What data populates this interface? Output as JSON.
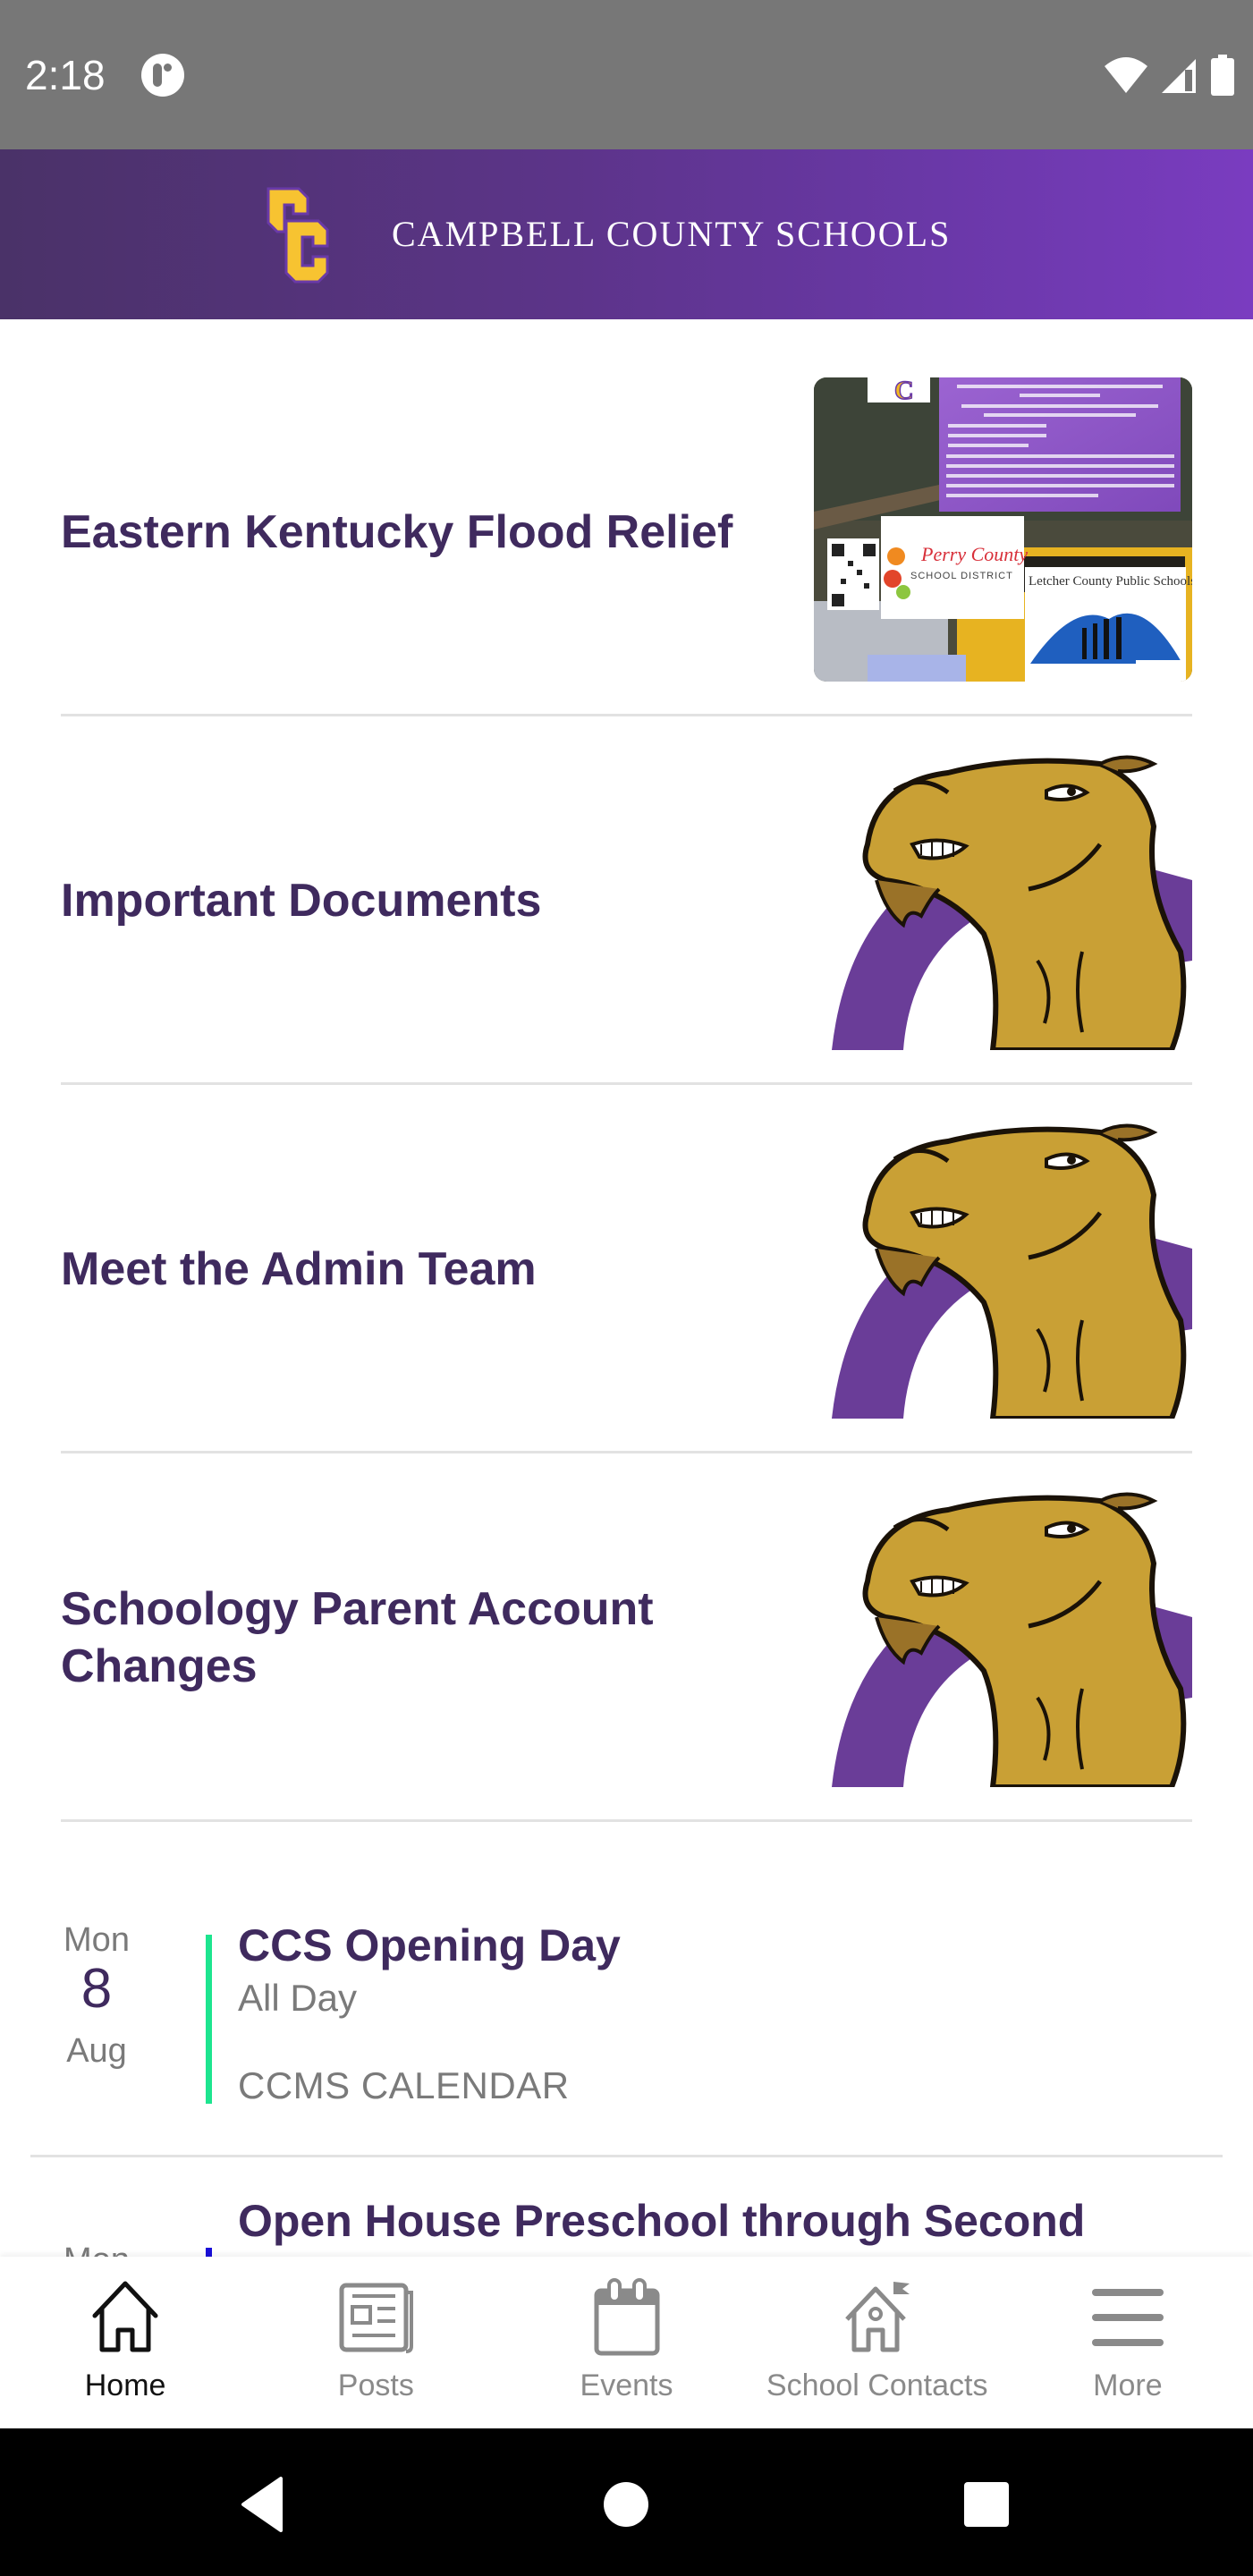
{
  "status_bar": {
    "time": "2:18",
    "app_icon": "notification-app-icon",
    "icons": [
      "wifi-icon",
      "cellular-signal-icon",
      "battery-icon"
    ]
  },
  "header": {
    "title": "CAMPBELL COUNTY SCHOOLS",
    "logo": "CC",
    "colors": {
      "gradient_start": "#4a3268",
      "gradient_end": "#7a3cc0",
      "logo_gold": "#f7c331",
      "logo_outline": "#6a3aa8"
    }
  },
  "feature_items": [
    {
      "title": "Eastern Kentucky Flood Relief",
      "image": "flood-relief-flyer"
    },
    {
      "title": "Important Documents",
      "image": "camel-mascot"
    },
    {
      "title": "Meet the Admin Team",
      "image": "camel-mascot"
    },
    {
      "title": "Schoology Parent Account Changes",
      "image": "camel-mascot"
    }
  ],
  "flyer": {
    "text_lines": [
      "Recent flooding has devastated several eastern Kentucky school districts.",
      "Campbell County Schools is promoting monetary donations to three of the most impacted school districts."
    ],
    "bullets": [
      "Perry County School District",
      "Letcher County Public Schools",
      "Knott County Schools"
    ],
    "logo_perry": "Perry County",
    "logo_perry_sub": "SCHOOL DISTRICT",
    "logo_letcher": "Letcher County Public Schools"
  },
  "events": [
    {
      "day_of_week": "Mon",
      "day": "8",
      "month": "Aug",
      "title": "CCS Opening Day",
      "time": "All Day",
      "calendar": "CCMS CALENDAR",
      "accent_color": "#1de58f"
    },
    {
      "day_of_week": "Mon",
      "day": "",
      "month": "",
      "title": "Open House Preschool through Second",
      "time": "",
      "calendar": "",
      "accent_color": "#1a10d8"
    }
  ],
  "bottom_nav": [
    {
      "label": "Home",
      "icon": "home-icon",
      "active": true
    },
    {
      "label": "Posts",
      "icon": "newspaper-icon",
      "active": false
    },
    {
      "label": "Events",
      "icon": "calendar-icon",
      "active": false
    },
    {
      "label": "School Contacts",
      "icon": "school-flag-icon",
      "active": false
    },
    {
      "label": "More",
      "icon": "hamburger-menu-icon",
      "active": false
    }
  ],
  "colors": {
    "title_text": "#3f2a5e",
    "muted_text": "#7a7a7a",
    "divider": "#e2e2e2",
    "nav_inactive": "#8a8a8a"
  }
}
